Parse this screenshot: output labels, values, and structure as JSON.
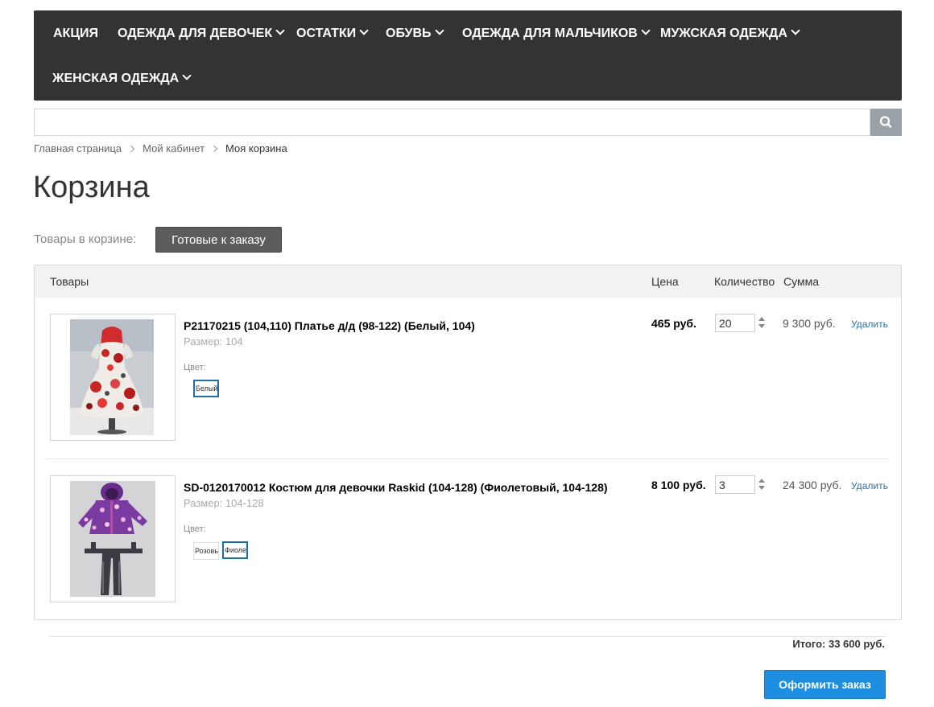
{
  "nav": {
    "items": [
      {
        "label": "АКЦИЯ",
        "has_dropdown": false
      },
      {
        "label": "ОДЕЖДА ДЛЯ ДЕВОЧЕК",
        "has_dropdown": true
      },
      {
        "label": "ОСТАТКИ",
        "has_dropdown": true
      },
      {
        "label": "ОБУВЬ",
        "has_dropdown": true
      },
      {
        "label": "ОДЕЖДА ДЛЯ МАЛЬЧИКОВ",
        "has_dropdown": true
      },
      {
        "label": "МУЖСКАЯ ОДЕЖДА",
        "has_dropdown": true
      },
      {
        "label": "ЖЕНСКАЯ ОДЕЖДА",
        "has_dropdown": true
      }
    ]
  },
  "search": {
    "value": "",
    "placeholder": "",
    "icon": "search-icon"
  },
  "breadcrumb": [
    "Главная страница",
    "Мой кабинет",
    "Моя корзина"
  ],
  "page": {
    "title": "Корзина"
  },
  "filter": {
    "label": "Товары в корзине:",
    "button": "Готовые к заказу"
  },
  "table": {
    "headers": {
      "goods": "Товары",
      "price": "Цена",
      "quantity": "Количество",
      "sum": "Сумма"
    },
    "rows": [
      {
        "title": "P21170215 (104,110) Платье д/д (98-122) (Белый, 104)",
        "size": "Размер: 104",
        "color_label": "Цвет:",
        "colors": [
          {
            "label": "Белый",
            "selected": true
          }
        ],
        "price": "465 руб.",
        "quantity": "20",
        "sum": "9 300 руб.",
        "delete": "Удалить",
        "image": "dress-photo"
      },
      {
        "title": "SD-0120170012 Костюм для девочки Raskid (104-128) (Фиолетовый, 104-128)",
        "size": "Размер: 104-128",
        "color_label": "Цвет:",
        "colors": [
          {
            "label": "Розовый",
            "selected": false
          },
          {
            "label": "Фиолетовый",
            "selected": true
          }
        ],
        "price": "8 100 руб.",
        "quantity": "3",
        "sum": "24 300 руб.",
        "delete": "Удалить",
        "image": "winter-suit-photo"
      }
    ]
  },
  "total": "Итого: 33 600 руб.",
  "checkout": {
    "label": "Оформить заказ"
  },
  "colors": {
    "nav_bg": "#333333",
    "checkout": "#1d8ee0",
    "selected_swatch": "#1b6fad",
    "link": "#2a6fb3"
  }
}
